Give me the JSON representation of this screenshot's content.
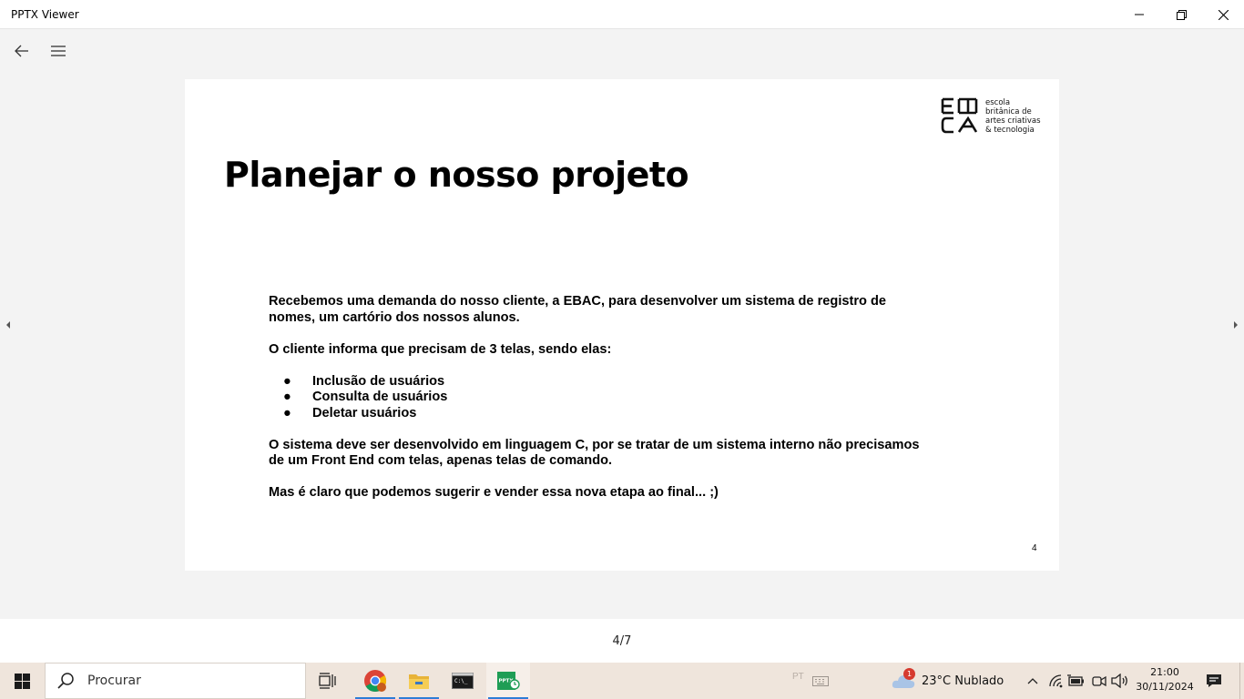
{
  "window": {
    "title": "PPTX Viewer"
  },
  "slide": {
    "logo": {
      "lines": [
        "escola",
        "britânica de",
        "artes criativas",
        "& tecnologia"
      ]
    },
    "title": "Planejar o nosso projeto",
    "paragraph1_line1": "Recebemos uma demanda do nosso cliente, a EBAC, para desenvolver um sistema de registro de",
    "paragraph1_line2": "nomes, um cartório dos nossos alunos.",
    "paragraph2": "O cliente informa que precisam de 3 telas, sendo elas:",
    "bullet_char": "●",
    "bullets": [
      "Inclusão de usuários",
      "Consulta de usuários",
      "Deletar usuários"
    ],
    "paragraph3_line1": "O sistema deve ser desenvolvido em linguagem C, por se tratar de um sistema interno não precisamos",
    "paragraph3_line2": "de um Front End com telas, apenas telas de comando.",
    "paragraph4": "Mas é claro que podemos sugerir e vender essa nova etapa ao final... ;)",
    "number": "4"
  },
  "pager": {
    "indicator": "4/7"
  },
  "taskbar": {
    "search_placeholder": "Procurar",
    "tray_faint_text": "PT",
    "weather": {
      "badge": "1",
      "text": "23°C  Nublado"
    },
    "clock": {
      "time": "21:00",
      "date": "30/11/2024"
    },
    "apps": [
      "chrome-icon",
      "file-explorer-icon",
      "command-prompt-icon",
      "pptx-viewer-icon"
    ]
  },
  "colors": {
    "taskbar": "#efe5dc",
    "active_indicator": "#2e7dd7",
    "app_bg": "#f3f3f3"
  }
}
